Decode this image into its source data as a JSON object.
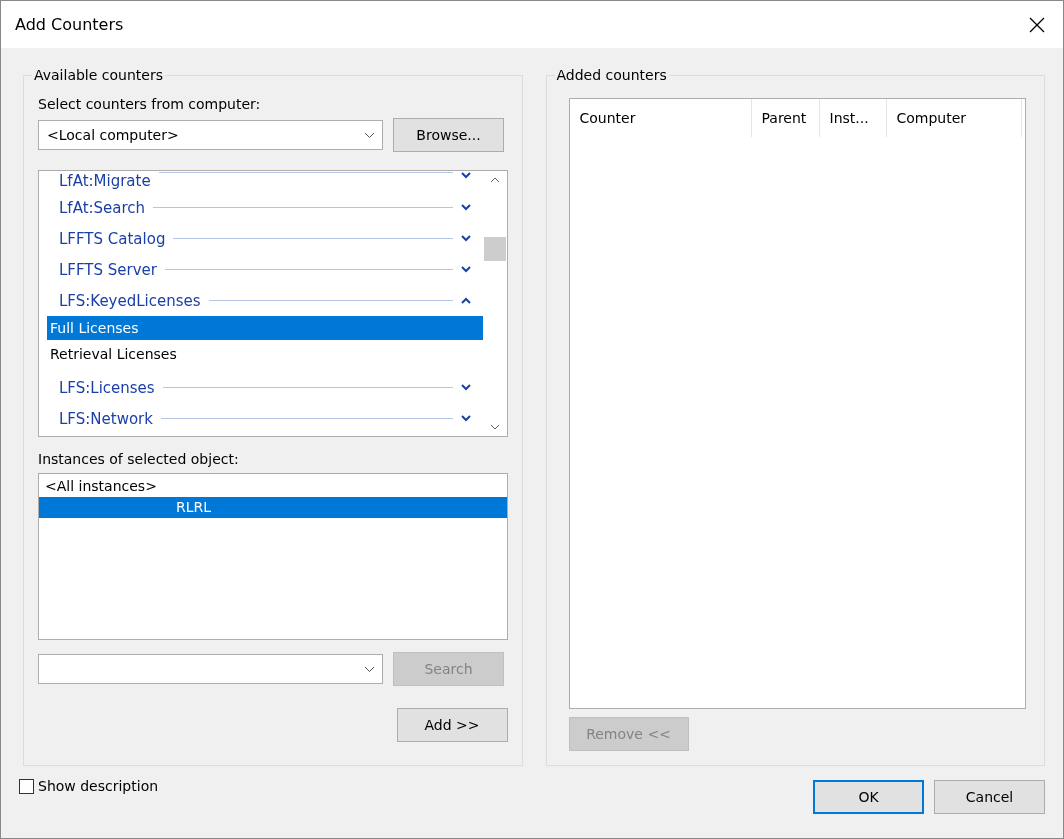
{
  "window": {
    "title": "Add Counters"
  },
  "available": {
    "title": "Available counters",
    "computer_label": "Select counters from computer:",
    "computer_value": "<Local computer>",
    "browse_button": {
      "label": "Browse...",
      "disabled": false
    },
    "objects": [
      {
        "label": "LfAt:Migrate",
        "expanded": false
      },
      {
        "label": "LfAt:Search",
        "expanded": false
      },
      {
        "label": "LFFTS Catalog",
        "expanded": false
      },
      {
        "label": "LFFTS Server",
        "expanded": false
      },
      {
        "label": "LFS:KeyedLicenses",
        "expanded": true,
        "children": [
          {
            "label": "Full Licenses",
            "selected": true
          },
          {
            "label": "Retrieval Licenses",
            "selected": false
          }
        ]
      },
      {
        "label": "LFS:Licenses",
        "expanded": false
      },
      {
        "label": "LFS:Network",
        "expanded": false
      }
    ],
    "instances_label": "Instances of selected object:",
    "instances": [
      {
        "label": "<All instances>",
        "selected": false
      },
      {
        "label": "RLRL",
        "selected": true
      }
    ],
    "search_button": {
      "label": "Search",
      "disabled": true
    },
    "add_button": {
      "label": "Add >>",
      "disabled": false
    }
  },
  "added": {
    "title": "Added counters",
    "columns": [
      "Counter",
      "Parent",
      "Inst...",
      "Computer"
    ],
    "remove_button": {
      "label": "Remove <<",
      "disabled": true
    }
  },
  "show_description": {
    "label": "Show description",
    "checked": false
  },
  "buttons": [
    {
      "label": "OK",
      "default": true
    },
    {
      "label": "Cancel",
      "default": false
    }
  ]
}
